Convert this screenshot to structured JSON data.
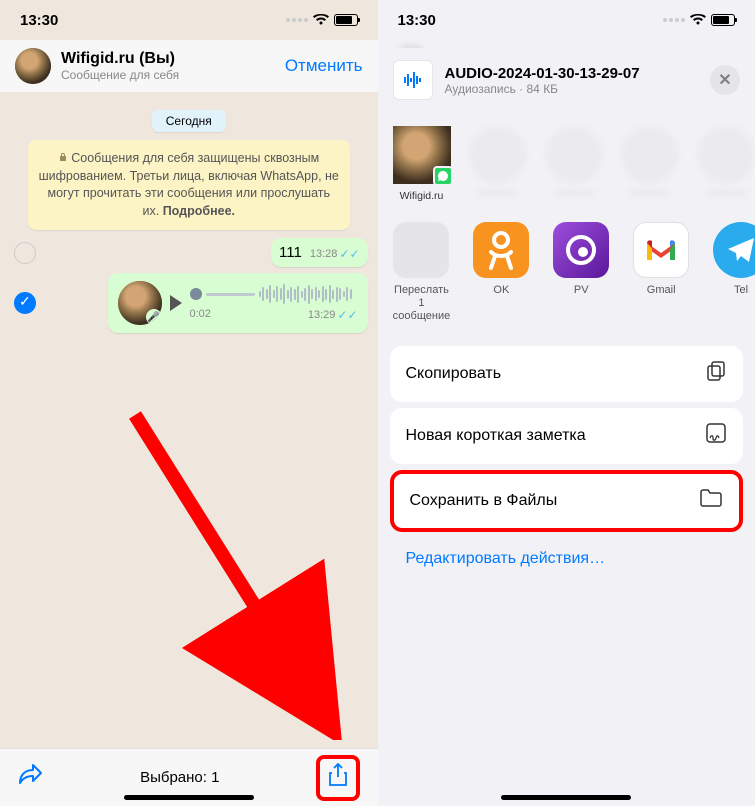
{
  "status_bar": {
    "time": "13:30"
  },
  "left": {
    "header": {
      "title": "Wifigid.ru (Вы)",
      "subtitle": "Сообщение для себя",
      "cancel": "Отменить"
    },
    "date_label": "Сегодня",
    "encryption": "Сообщения для себя защищены сквозным шифрованием. Третьи лица, включая WhatsApp, не могут прочитать эти сообщения или прослушать их.",
    "encryption_more": "Подробнее.",
    "messages": {
      "text_msg": {
        "content": "111",
        "time": "13:28"
      },
      "voice_msg": {
        "duration": "0:02",
        "time": "13:29"
      }
    },
    "bottom": {
      "selected": "Выбрано: 1"
    }
  },
  "right": {
    "file": {
      "name": "AUDIO-2024-01-30-13-29-07",
      "meta": "Аудиозапись · 84 КБ"
    },
    "contacts": [
      {
        "label": "Wifigid.ru"
      }
    ],
    "apps": {
      "forward": "Переслать 1 сообщение",
      "ok": "OK",
      "pv": "PV",
      "gmail": "Gmail",
      "telegram": "Tel"
    },
    "actions": {
      "copy": "Скопировать",
      "note": "Новая короткая заметка",
      "save_files": "Сохранить в Файлы"
    },
    "edit_actions": "Редактировать действия…"
  }
}
